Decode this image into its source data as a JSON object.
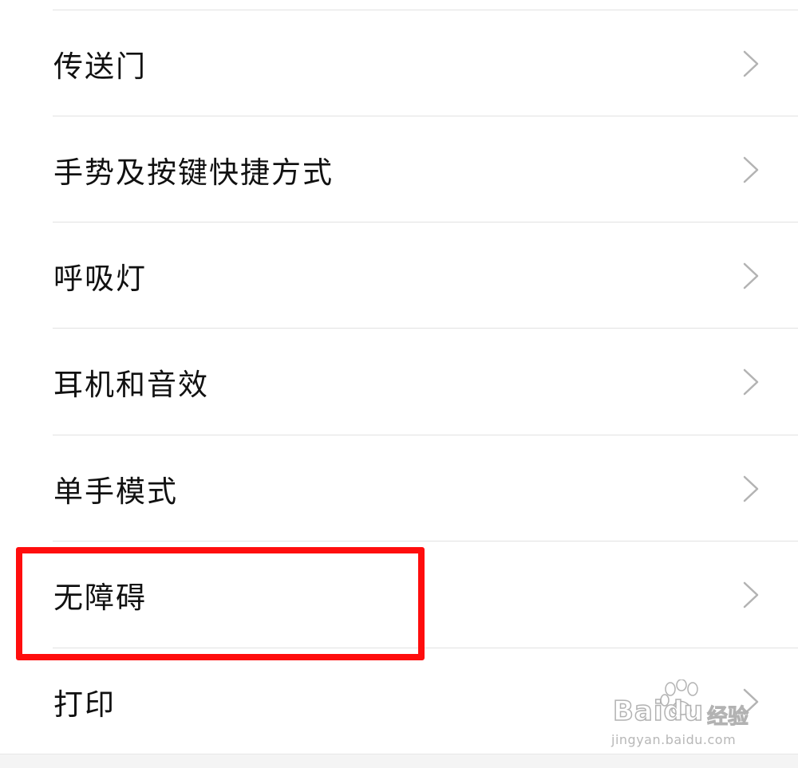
{
  "settings": {
    "items": [
      {
        "label": "传送门",
        "icon": "chevron-right-icon"
      },
      {
        "label": "手势及按键快捷方式",
        "icon": "chevron-right-icon"
      },
      {
        "label": "呼吸灯",
        "icon": "chevron-right-icon"
      },
      {
        "label": "耳机和音效",
        "icon": "chevron-right-icon"
      },
      {
        "label": "单手模式",
        "icon": "chevron-right-icon"
      },
      {
        "label": "无障碍",
        "icon": "chevron-right-icon"
      },
      {
        "label": "打印",
        "icon": "chevron-right-icon"
      }
    ],
    "highlighted_item": "无障碍"
  },
  "watermark": {
    "brand": "Baidu",
    "brand_cn": "经验",
    "url": "jingyan.baidu.com"
  },
  "colors": {
    "background": "#ffffff",
    "text": "#111111",
    "divider": "#e2e2e2",
    "chevron": "#b3b3b3",
    "highlight": "#ff0d0d"
  }
}
